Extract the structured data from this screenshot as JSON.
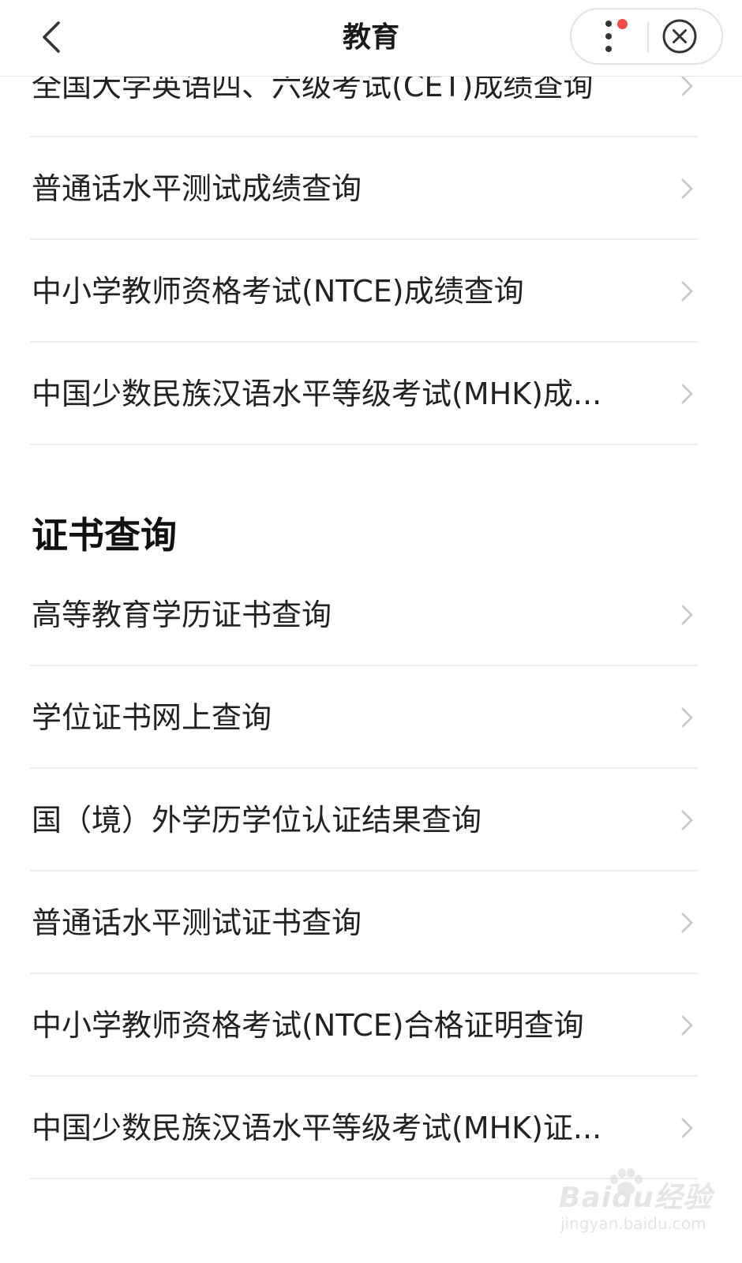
{
  "header": {
    "title": "教育",
    "back_icon": "chevron-left-icon",
    "more_icon": "more-vertical-icon",
    "close_icon": "close-circle-icon",
    "notification_color": "#f24b46"
  },
  "score_section": {
    "items": [
      {
        "label": "全国大学英语四、六级考试(CET)成绩查询"
      },
      {
        "label": "普通话水平测试成绩查询"
      },
      {
        "label": "中小学教师资格考试(NTCE)成绩查询"
      },
      {
        "label": "中国少数民族汉语水平等级考试(MHK)成..."
      }
    ]
  },
  "certificate_section": {
    "title": "证书查询",
    "items": [
      {
        "label": "高等教育学历证书查询"
      },
      {
        "label": "学位证书网上查询"
      },
      {
        "label": "国（境）外学历学位认证结果查询"
      },
      {
        "label": "普通话水平测试证书查询"
      },
      {
        "label": "中小学教师资格考试(NTCE)合格证明查询"
      },
      {
        "label": "中国少数民族汉语水平等级考试(MHK)证..."
      }
    ]
  },
  "watermark": {
    "logo": "Baidu经验",
    "url": "jingyan.baidu.com"
  }
}
